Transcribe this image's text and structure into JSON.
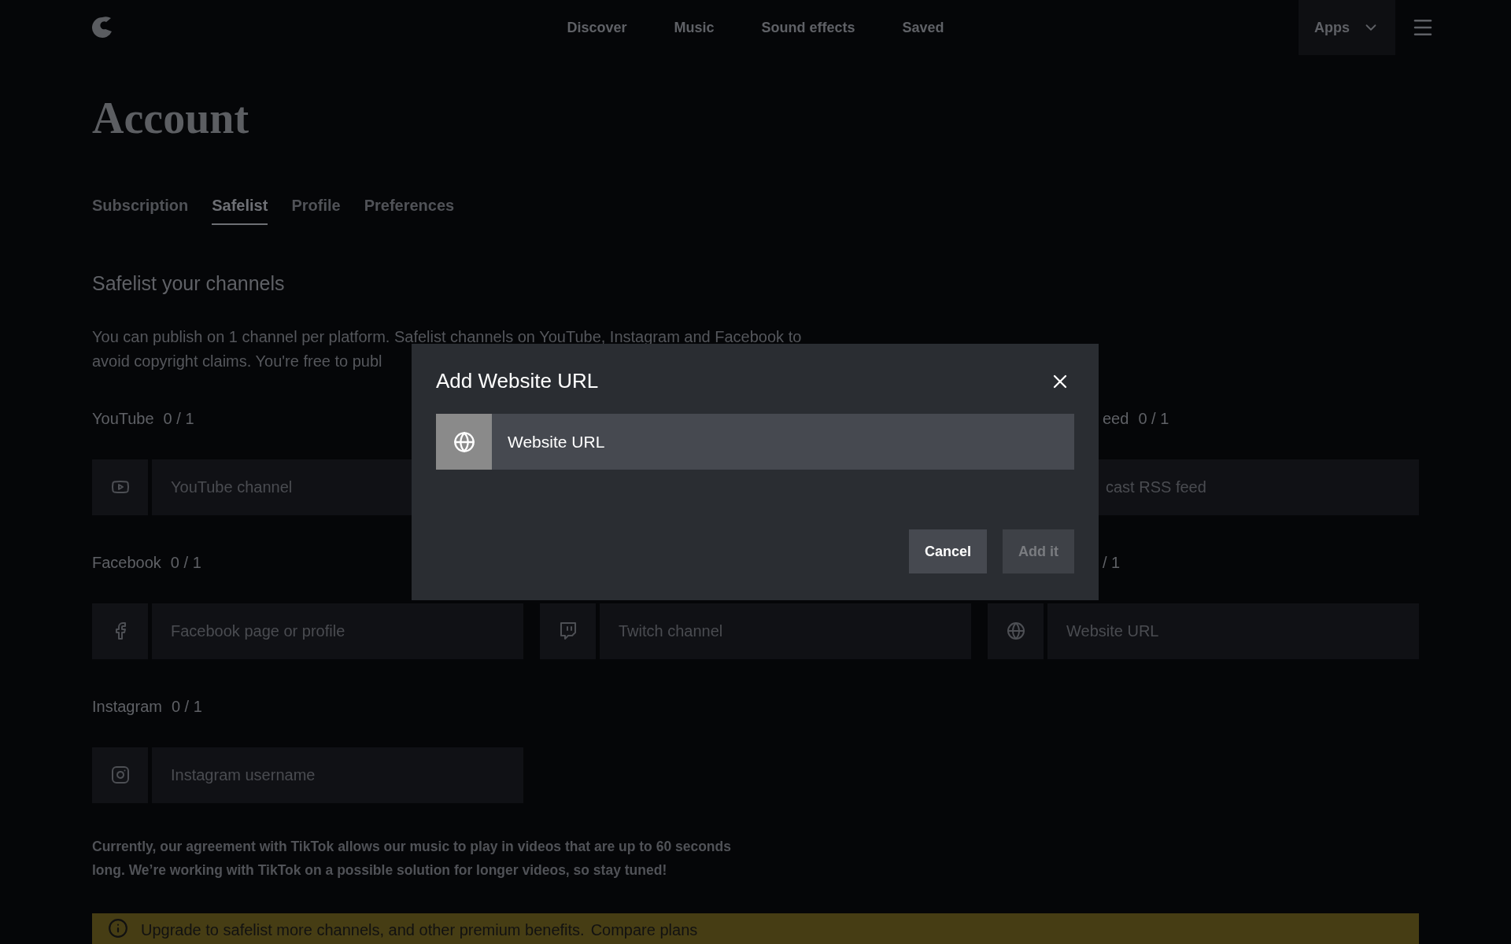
{
  "nav": {
    "links": [
      "Discover",
      "Music",
      "Sound effects",
      "Saved"
    ],
    "apps_button": "Apps"
  },
  "page_title": "Account",
  "tabs": [
    {
      "label": "Subscription",
      "selected": false
    },
    {
      "label": "Safelist",
      "selected": true
    },
    {
      "label": "Profile",
      "selected": false
    },
    {
      "label": "Preferences",
      "selected": false
    }
  ],
  "section_title": "Safelist your channels",
  "intro_lines": [
    "You can publish on 1 channel per platform. Safelist channels on YouTube, Instagram and Facebook to",
    "avoid copyright claims. You're free to publ"
  ],
  "channel_rows": [
    [
      {
        "kind": "youtube",
        "label": "YouTube",
        "count": "0 / 1",
        "placeholder": "YouTube channel"
      },
      {
        "kind": "hidden"
      },
      {
        "kind": "podcast",
        "label": "eed",
        "count": "0 / 1",
        "placeholder": "cast RSS feed"
      }
    ],
    [
      {
        "kind": "facebook",
        "label": "Facebook",
        "count": "0 / 1",
        "placeholder": "Facebook page or profile"
      },
      {
        "kind": "twitch",
        "placeholder": "Twitch channel"
      },
      {
        "kind": "website",
        "count": "/ 1",
        "placeholder": "Website URL"
      }
    ],
    [
      {
        "kind": "instagram",
        "label": "Instagram",
        "count": "0 / 1",
        "placeholder": "Instagram username"
      }
    ]
  ],
  "tiktok_note": "Currently, our agreement with TikTok allows our music to play in videos that are up to 60 seconds long. We’re working with TikTok on a possible solution for longer videos, so stay tuned!",
  "upgrade_banner": {
    "text": "Upgrade to safelist more channels, and other premium benefits.",
    "link": "Compare plans"
  },
  "dialog": {
    "title": "Add Website URL",
    "field": {
      "placeholder": "Website URL"
    },
    "buttons": [
      {
        "label": "Cancel",
        "disabled": false
      },
      {
        "label": "Add it",
        "disabled": true
      }
    ]
  }
}
